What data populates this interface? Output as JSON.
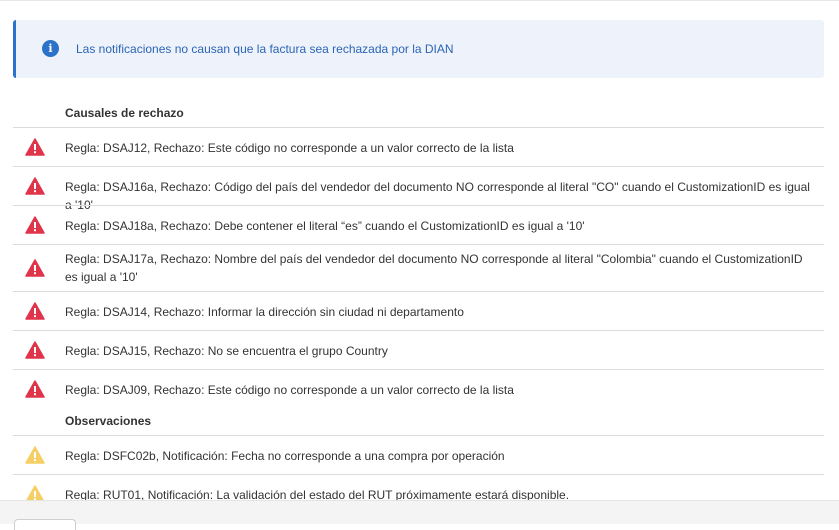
{
  "alert": {
    "text": "Las notificaciones no causan que la factura sea rechazada por la DIAN",
    "icon": "info-icon",
    "color": "#2b72c8"
  },
  "rejections": {
    "title": "Causales de rechazo",
    "icon": "error-triangle-icon",
    "icon_color": "#e0344b",
    "items": [
      "Regla: DSAJ12, Rechazo: Este código no corresponde a un valor correcto de la lista",
      "Regla: DSAJ16a, Rechazo: Código del país del vendedor del documento NO corresponde al literal \"CO\" cuando el CustomizationID es igual a '10'",
      "Regla: DSAJ18a, Rechazo: Debe contener el literal “es” cuando el CustomizationID es igual a '10'",
      "Regla: DSAJ17a, Rechazo: Nombre del país del vendedor del documento NO corresponde al literal \"Colombia\" cuando el CustomizationID es igual a '10'",
      "Regla: DSAJ14, Rechazo: Informar la dirección sin ciudad ni departamento",
      "Regla: DSAJ15, Rechazo: No se encuentra el grupo Country",
      "Regla: DSAJ09, Rechazo: Este código no corresponde a un valor correcto de la lista"
    ]
  },
  "observations": {
    "title": "Observaciones",
    "icon": "warning-triangle-icon",
    "icon_color": "#f5cf63",
    "items": [
      "Regla: DSFC02b, Notificación: Fecha no corresponde a una compra por operación",
      "Regla: RUT01, Notificación: La validación del estado del RUT próximamente estará disponible."
    ]
  }
}
